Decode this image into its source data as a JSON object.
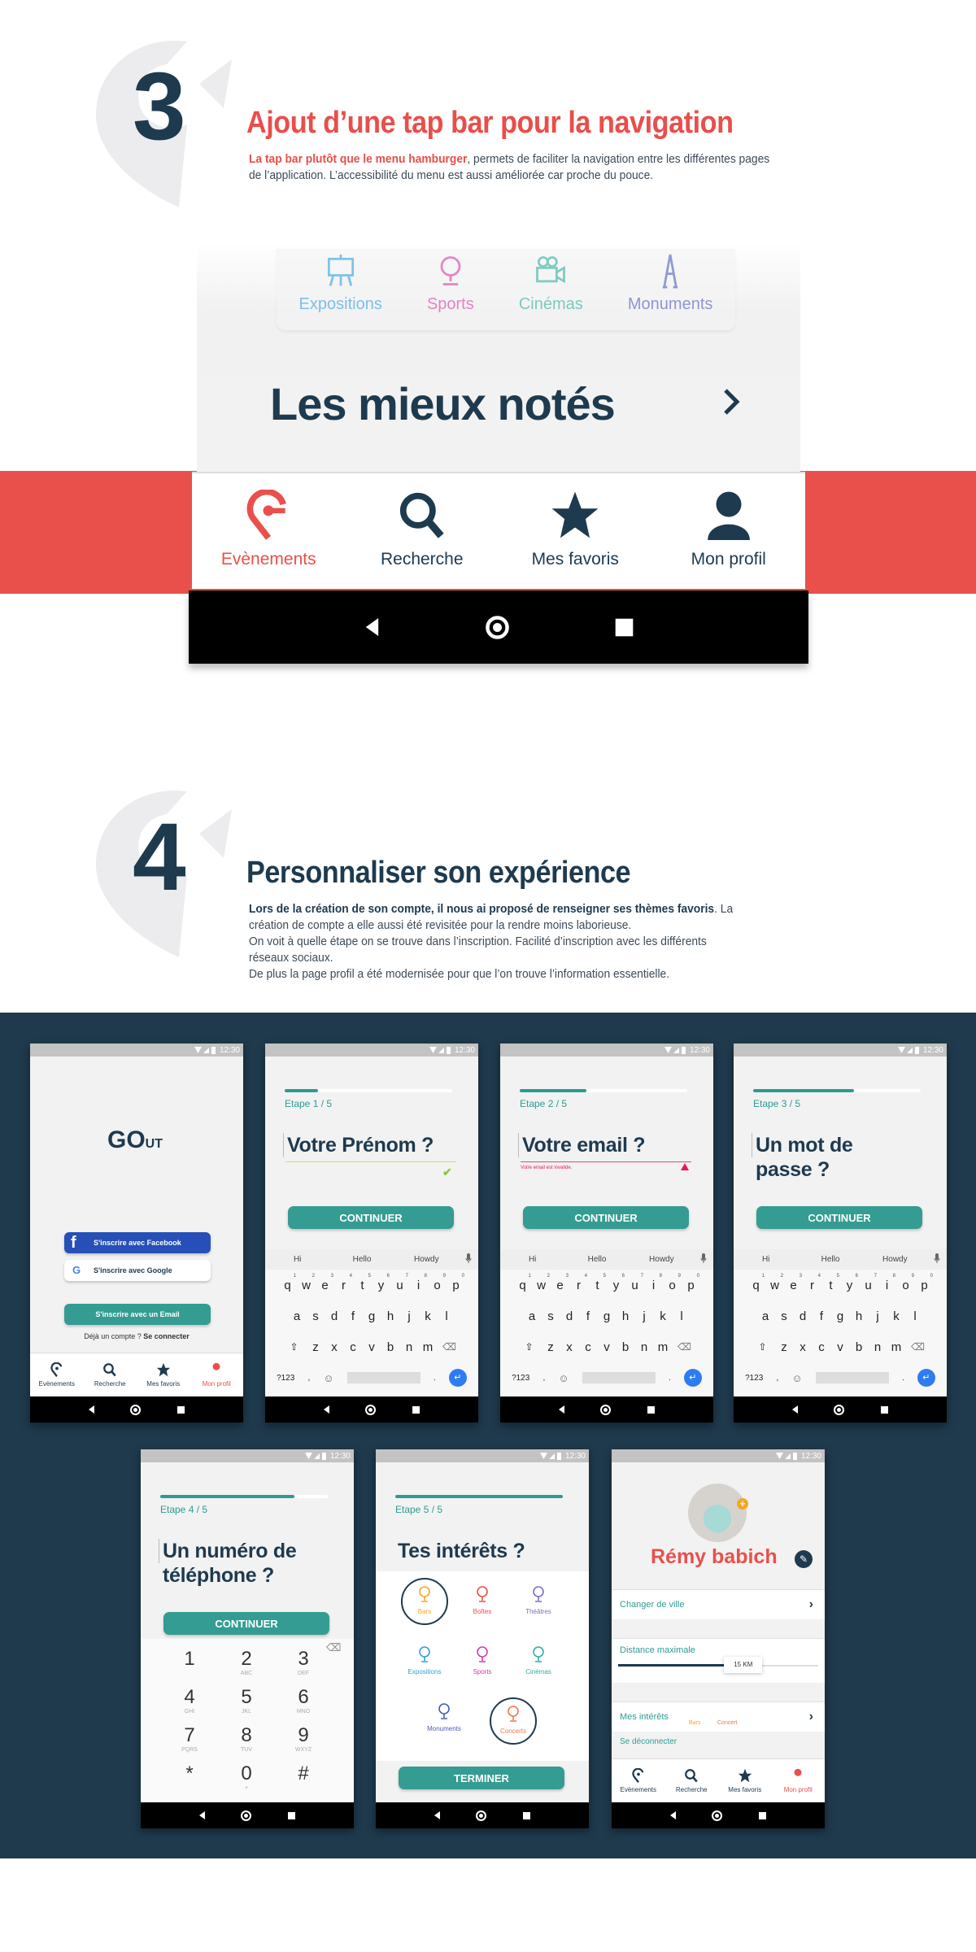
{
  "section3": {
    "number": "3",
    "title": "Ajout d’une tap bar pour la navigation",
    "text_highlight": "La tap bar plutôt que le menu hamburger",
    "text_rest": ", permets de faciliter la navigation entre les différentes pages de l’application. L’accessibilité du menu est aussi améliorée car proche du pouce."
  },
  "hero": {
    "categories": [
      "Expositions",
      "Sports",
      "Cinémas",
      "Monuments"
    ],
    "title": "Les mieux notés",
    "tabs": [
      "Evènements",
      "Recherche",
      "Mes favoris",
      "Mon profil"
    ],
    "active_tab": "Evènements"
  },
  "section4": {
    "number": "4",
    "title": "Personnaliser son expérience",
    "text_bold": "Lors de la création de son compte, il nous ai proposé de renseigner ses thèmes favoris",
    "text_1": ". La création de compte a elle aussi été revisitée pour la rendre moins laborieuse.",
    "text_2": "On voit à quelle étape on se trouve dans l’inscription. Facilité d’inscription avec les différents réseaux sociaux.",
    "text_3": "De plus la page profil a été modernisée pour que l’on trouve l’information essentielle."
  },
  "status_time": "12:30",
  "colors": {
    "accent_red": "#e9504c",
    "teal": "#349c93",
    "navy": "#1e3a4f",
    "dark_bg": "#1f394d",
    "facebook": "#2650b8"
  },
  "tabbar": [
    "Evènements",
    "Recherche",
    "Mes favoris",
    "Mon profil"
  ],
  "login": {
    "logo_main": "GO",
    "logo_sub": "UT",
    "facebook": "S'inscrire avec Facebook",
    "google": "S'inscrire avec Google",
    "email": "S'inscrire avec un Email",
    "have_account": "Déjà un compte ?",
    "login_link": "Se connecter",
    "active_tab": "Mon profil"
  },
  "continue_label": "CONTINUER",
  "keyboard": {
    "suggestions": [
      "Hi",
      "Hello",
      "Howdy"
    ],
    "row1": [
      "q",
      "w",
      "e",
      "r",
      "t",
      "y",
      "u",
      "i",
      "o",
      "p"
    ],
    "row1_nums": [
      "1",
      "2",
      "3",
      "4",
      "5",
      "6",
      "7",
      "8",
      "9",
      "0"
    ],
    "row2": [
      "a",
      "s",
      "d",
      "f",
      "g",
      "h",
      "j",
      "k",
      "l"
    ],
    "row3": [
      "z",
      "x",
      "c",
      "v",
      "b",
      "n",
      "m"
    ],
    "symbols": "?123",
    "comma": ",",
    "period": "."
  },
  "steps": [
    {
      "etape": "Etape 1 / 5",
      "progress": 0.2,
      "question": "Votre Prénom ?",
      "state": "valid"
    },
    {
      "etape": "Etape 2 / 5",
      "progress": 0.4,
      "question": "Votre email ?",
      "state": "error",
      "error": "Votre email est invalide."
    },
    {
      "etape": "Etape 3 / 5",
      "progress": 0.6,
      "question": "Un mot de passe ?"
    },
    {
      "etape": "Etape 4 / 5",
      "progress": 0.8,
      "question": "Un numéro de téléphone ?"
    },
    {
      "etape": "Etape 5 / 5",
      "progress": 1.0,
      "question": "Tes intérêts ?"
    }
  ],
  "dialpad": [
    {
      "d": "1",
      "l": ""
    },
    {
      "d": "2",
      "l": "ABC"
    },
    {
      "d": "3",
      "l": "DEF"
    },
    {
      "d": "4",
      "l": "GHI"
    },
    {
      "d": "5",
      "l": "JKL"
    },
    {
      "d": "6",
      "l": "MNO"
    },
    {
      "d": "7",
      "l": "PQRS"
    },
    {
      "d": "8",
      "l": "TUV"
    },
    {
      "d": "9",
      "l": "WXYZ"
    },
    {
      "d": "*",
      "l": ""
    },
    {
      "d": "0",
      "l": "+"
    },
    {
      "d": "#",
      "l": ""
    }
  ],
  "interests": [
    {
      "label": "Bars",
      "color": "#f5a623",
      "selected": true
    },
    {
      "label": "Boîtes",
      "color": "#e9504c",
      "selected": false
    },
    {
      "label": "Théâtres",
      "color": "#7b6fc4",
      "selected": false
    },
    {
      "label": "Expositions",
      "color": "#2b9fe0",
      "selected": false
    },
    {
      "label": "Sports",
      "color": "#d63aa8",
      "selected": false
    },
    {
      "label": "Cinémas",
      "color": "#2eaea0",
      "selected": false
    },
    {
      "label": "Monuments",
      "color": "#4a5bb8",
      "selected": false
    },
    {
      "label": "Concerts",
      "color": "#f0754a",
      "selected": true
    }
  ],
  "finish_label": "TERMINER",
  "profile": {
    "name": "Rémy babich",
    "change_city": "Changer de ville",
    "distance_label": "Distance maximale",
    "distance_value": "15 KM",
    "distance_fraction": 0.55,
    "interests_label": "Mes intérêts",
    "interests": [
      "Bars",
      "Concert"
    ],
    "logout": "Se déconnecter",
    "active_tab": "Mon profil"
  }
}
